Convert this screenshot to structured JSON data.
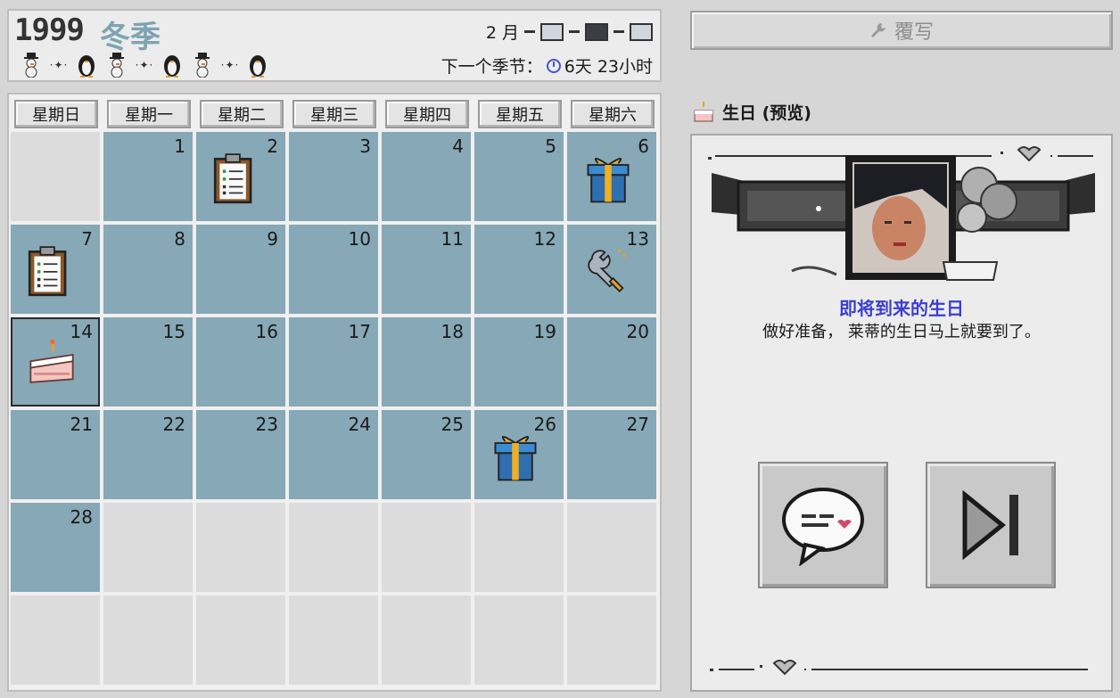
{
  "header": {
    "year": "1999",
    "season": "冬季",
    "month_label": "2 月",
    "next_season_label": "下一个季节：",
    "next_season_value": "6天 23小时",
    "decorations": [
      "snowman-icon",
      "sparkle-icon",
      "penguin-icon",
      "snowman-icon",
      "sparkle-icon",
      "penguin-icon",
      "snowman-icon",
      "sparkle-icon",
      "penguin-icon"
    ]
  },
  "calendar": {
    "weekdays": [
      "星期日",
      "星期一",
      "星期二",
      "星期三",
      "星期四",
      "星期五",
      "星期六"
    ],
    "days": [
      "1",
      "2",
      "3",
      "4",
      "5",
      "6",
      "7",
      "8",
      "9",
      "10",
      "11",
      "12",
      "13",
      "14",
      "15",
      "16",
      "17",
      "18",
      "19",
      "20",
      "21",
      "22",
      "23",
      "24",
      "25",
      "26",
      "27",
      "28"
    ],
    "first_weekday_index": 1,
    "selected_day": "14",
    "events": {
      "2": "clipboard-icon",
      "6": "gift-icon",
      "7": "clipboard-icon",
      "13": "wrench-icon",
      "14": "cake-icon",
      "26": "gift-icon"
    }
  },
  "sidebar": {
    "overwrite_label": "覆写",
    "preview_title": "生日 (预览)",
    "event_title": "即将到来的生日",
    "event_desc": "做好准备， 莱蒂的生日马上就要到了。"
  },
  "colors": {
    "active_day": "#87a8b6",
    "inactive_day": "#dcdcdc",
    "season": "#7ea4b3",
    "event_title": "#3a3fd0"
  }
}
